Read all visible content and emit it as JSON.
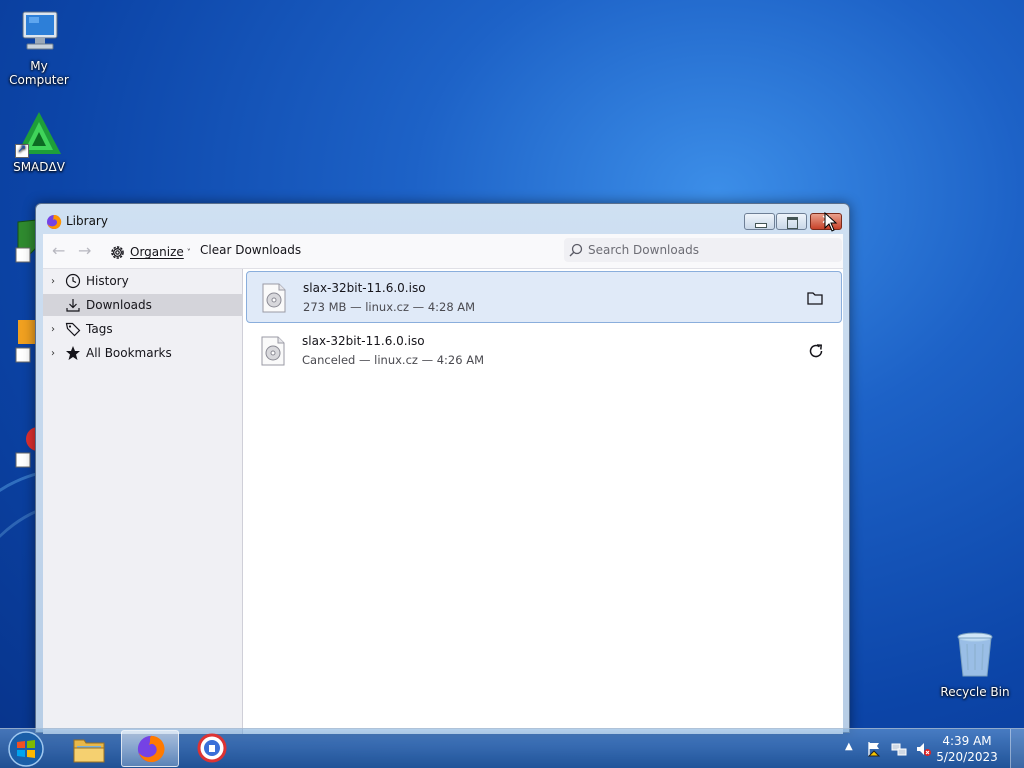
{
  "desktop": {
    "icons": [
      {
        "label": "My Computer"
      },
      {
        "label": "SMADΔV"
      },
      {
        "label": "Recycle Bin"
      }
    ]
  },
  "window": {
    "title": "Library",
    "toolbar": {
      "organize_label": "Organize",
      "clear_label": "Clear Downloads",
      "search_placeholder": "Search Downloads"
    },
    "sidebar": {
      "items": [
        {
          "label": "History",
          "icon": "clock-icon",
          "expandable": true
        },
        {
          "label": "Downloads",
          "icon": "download-icon",
          "expandable": false,
          "selected": true
        },
        {
          "label": "Tags",
          "icon": "tag-icon",
          "expandable": true
        },
        {
          "label": "All Bookmarks",
          "icon": "star-icon",
          "expandable": true
        }
      ]
    },
    "downloads": [
      {
        "name": "slax-32bit-11.6.0.iso",
        "status": "273 MB — linux.cz — 4:28 AM",
        "action_icon": "folder-icon",
        "selected": true
      },
      {
        "name": "slax-32bit-11.6.0.iso",
        "status": "Canceled — linux.cz — 4:26 AM",
        "action_icon": "retry-icon",
        "selected": false
      }
    ]
  },
  "taskbar": {
    "time": "4:39 AM",
    "date": "5/20/2023"
  },
  "colors": {
    "selection_bg": "#e0eaf8",
    "selection_border": "#8aaedc",
    "sidebar_bg": "#f0f0f4"
  }
}
